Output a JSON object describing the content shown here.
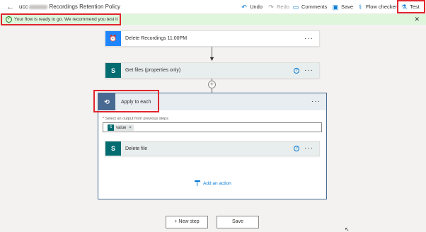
{
  "header": {
    "title_prefix": "ucc",
    "title_suffix": "Recordings Retention Policy",
    "commands": [
      {
        "label": "Undo",
        "icon": "undo-icon",
        "glyph": "↶",
        "enabled": true
      },
      {
        "label": "Redo",
        "icon": "redo-icon",
        "glyph": "↷",
        "enabled": false
      },
      {
        "label": "Comments",
        "icon": "comment-icon",
        "glyph": "▭",
        "enabled": true
      },
      {
        "label": "Save",
        "icon": "save-icon",
        "glyph": "▣",
        "enabled": true
      },
      {
        "label": "Flow checker",
        "icon": "stethoscope-icon",
        "glyph": "⚕",
        "enabled": true
      },
      {
        "label": "Test",
        "icon": "beaker-icon",
        "glyph": "⚗",
        "enabled": true
      }
    ]
  },
  "banner": {
    "message": "Your flow is ready to go. We recommend you test it",
    "close_glyph": "✕"
  },
  "steps": {
    "trigger": {
      "label": "Delete Recordings 11:00PM",
      "icon": "alarm-clock-icon",
      "glyph": "⏰",
      "more": "···"
    },
    "get_files": {
      "label": "Get files (properties only)",
      "icon": "sharepoint-icon",
      "glyph": "S",
      "info": "?",
      "more": "···"
    },
    "apply_each": {
      "label": "Apply to each",
      "icon": "loop-icon",
      "glyph": "⟲",
      "more": "···",
      "required_mark": "*",
      "field_label": "Select an output from previous steps",
      "token": {
        "label": "value",
        "icon": "sharepoint-icon",
        "glyph": "S",
        "remove": "×"
      },
      "inner": {
        "label": "Delete file",
        "icon": "sharepoint-icon",
        "glyph": "S",
        "info": "?",
        "more": "···"
      },
      "add_action": "Add an action"
    }
  },
  "footer": {
    "new_step": "+ New step",
    "save": "Save"
  },
  "colors": {
    "highlight": "#e0262d",
    "banner_bg": "#dff6dd",
    "accent": "#0078d4",
    "sharepoint": "#036c70",
    "recurrence": "#1f85ff",
    "loop": "#486991"
  }
}
